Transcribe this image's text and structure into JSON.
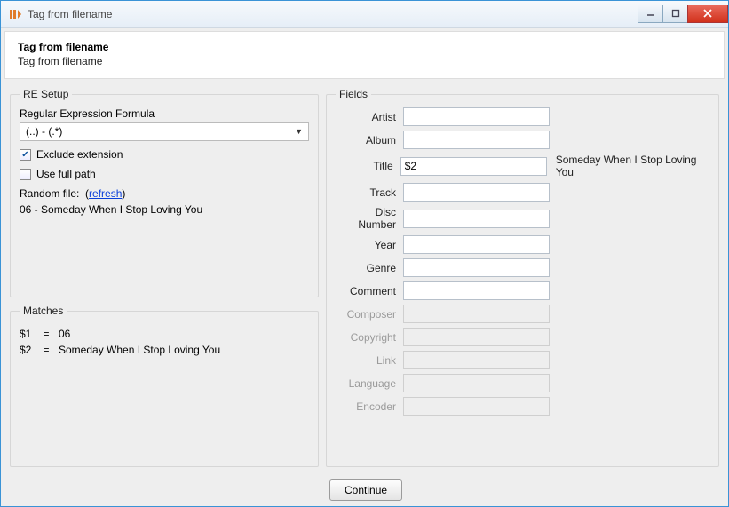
{
  "window": {
    "title": "Tag from filename"
  },
  "header": {
    "title": "Tag from filename",
    "subtitle": "Tag from filename"
  },
  "re_setup": {
    "legend": "RE Setup",
    "formula_label": "Regular Expression Formula",
    "formula_value": "(..) - (.*)",
    "exclude_ext_label": "Exclude extension",
    "exclude_ext_checked": true,
    "use_full_path_label": "Use full path",
    "use_full_path_checked": false,
    "random_file_label": "Random file:",
    "refresh_label": "refresh",
    "random_file_value": "06 - Someday When I Stop Loving You"
  },
  "matches": {
    "legend": "Matches",
    "rows": [
      {
        "key": "$1",
        "value": "06"
      },
      {
        "key": "$2",
        "value": "Someday When I Stop Loving You"
      }
    ]
  },
  "fields": {
    "legend": "Fields",
    "items": [
      {
        "label": "Artist",
        "value": "",
        "enabled": true,
        "preview": ""
      },
      {
        "label": "Album",
        "value": "",
        "enabled": true,
        "preview": ""
      },
      {
        "label": "Title",
        "value": "$2",
        "enabled": true,
        "preview": "Someday When I Stop Loving You"
      },
      {
        "label": "Track",
        "value": "",
        "enabled": true,
        "preview": ""
      },
      {
        "label": "Disc Number",
        "value": "",
        "enabled": true,
        "preview": ""
      },
      {
        "label": "Year",
        "value": "",
        "enabled": true,
        "preview": ""
      },
      {
        "label": "Genre",
        "value": "",
        "enabled": true,
        "preview": ""
      },
      {
        "label": "Comment",
        "value": "",
        "enabled": true,
        "preview": ""
      },
      {
        "label": "Composer",
        "value": "",
        "enabled": false,
        "preview": ""
      },
      {
        "label": "Copyright",
        "value": "",
        "enabled": false,
        "preview": ""
      },
      {
        "label": "Link",
        "value": "",
        "enabled": false,
        "preview": ""
      },
      {
        "label": "Language",
        "value": "",
        "enabled": false,
        "preview": ""
      },
      {
        "label": "Encoder",
        "value": "",
        "enabled": false,
        "preview": ""
      }
    ]
  },
  "footer": {
    "continue_label": "Continue"
  }
}
